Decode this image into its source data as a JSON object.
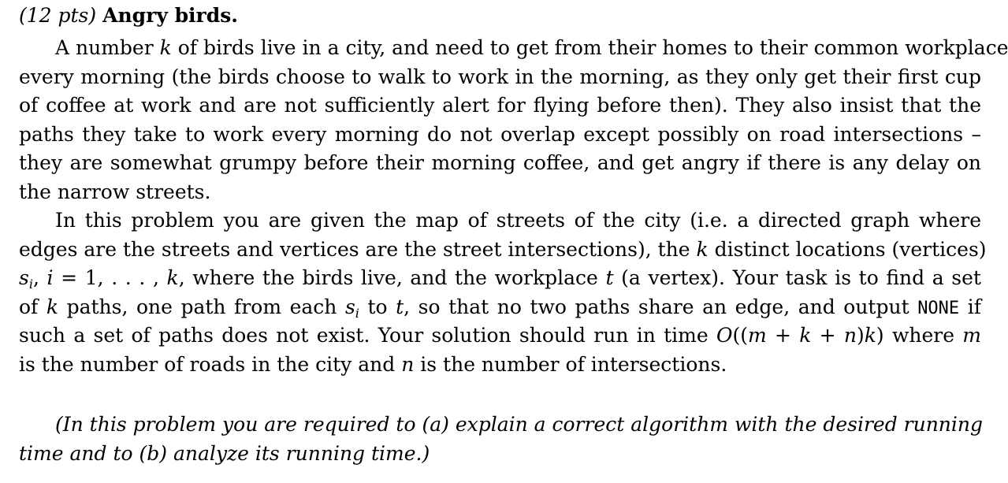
{
  "problem": {
    "points": "(12 pts)",
    "title": "Angry birds.",
    "lines": [
      [
        "A number ",
        "k",
        " of birds live in a city, and need to get from their homes to their common workplace"
      ],
      [
        "every morning (the birds choose to walk to work in the morning, as they only get their first cup"
      ],
      [
        "of coffee at work and are not sufficiently alert for flying before then). They also insist that the"
      ],
      [
        "paths they take to work every morning do not overlap except possibly on road intersections –"
      ],
      [
        "they are somewhat grumpy before their morning coffee, and get angry if there is any delay on"
      ],
      [
        "the narrow streets."
      ],
      [
        "In this problem you are given the map of streets of the city (i.e. a directed graph where"
      ],
      [
        "edges are the streets and vertices are the street intersections), the ",
        "k",
        " distinct locations (vertices)"
      ],
      [
        "s",
        "i",
        ", ",
        "i",
        " = 1, . . . , ",
        "k",
        ", where the birds live, and the workplace ",
        "t",
        " (a vertex). Your task is to find a set"
      ],
      [
        "of ",
        "k",
        " paths, one path from each ",
        "s",
        "i",
        " to ",
        "t",
        ", so that no two paths share an edge, and output ",
        "NONE",
        " if"
      ],
      [
        "such a set of paths does not exist. Your solution should run in time ",
        "O",
        "((",
        "m",
        " + ",
        "k",
        " + ",
        "n",
        ")",
        "k",
        ") where ",
        "m"
      ],
      [
        "is the number of roads in the city and ",
        "n",
        " is the number of intersections."
      ]
    ],
    "note_lines": [
      "(In this problem you are required to (a) explain a correct algorithm with the desired running",
      "time and to (b) analyze its running time.)"
    ]
  }
}
